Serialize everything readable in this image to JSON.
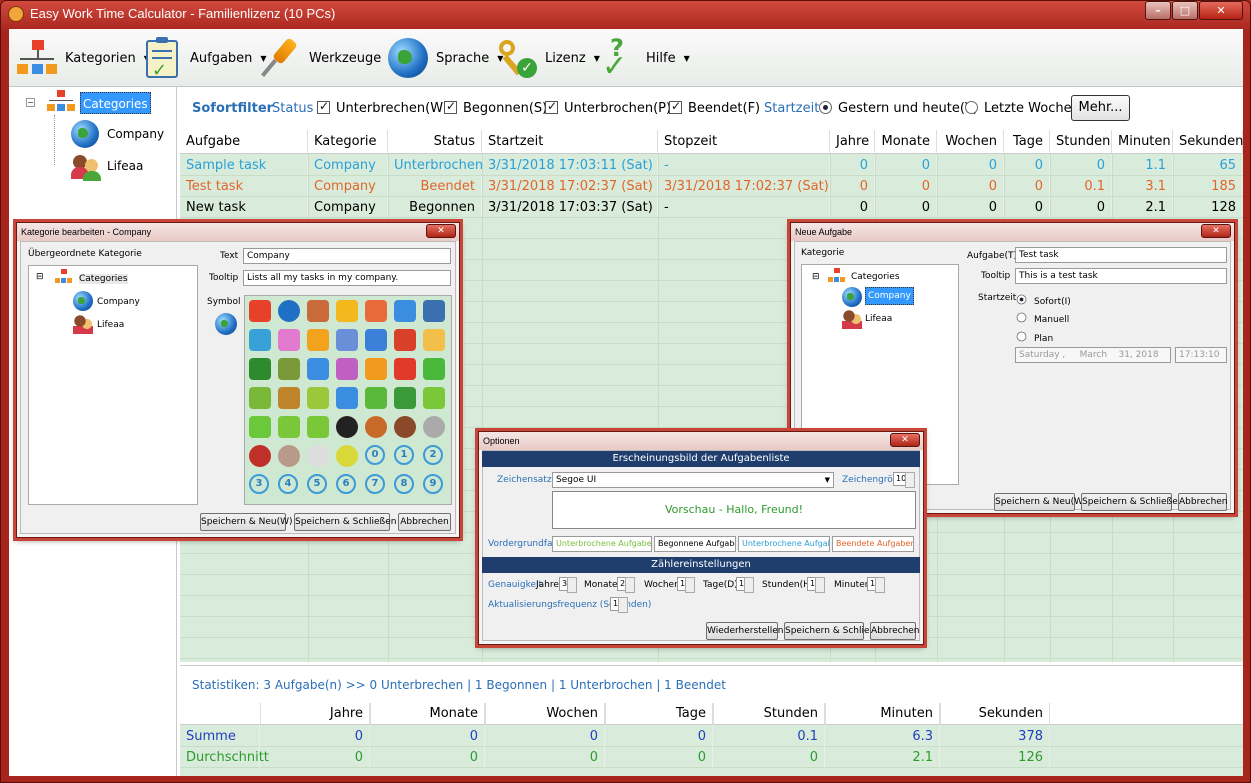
{
  "app": {
    "title": "Easy Work Time Calculator - Familienlizenz (10 PCs)"
  },
  "toolbar": [
    {
      "label": "Kategorien",
      "icon": "category-tree-icon"
    },
    {
      "label": "Aufgaben",
      "icon": "clipboard-icon"
    },
    {
      "label": "Werkzeuge",
      "icon": "screwdriver-icon"
    },
    {
      "label": "Sprache",
      "icon": "globe-icon"
    },
    {
      "label": "Lizenz",
      "icon": "keys-icon"
    },
    {
      "label": "Hilfe",
      "icon": "help-check-icon"
    }
  ],
  "tree": {
    "root": "Categories",
    "children": [
      "Company",
      "Lifeaa"
    ]
  },
  "filter": {
    "title": "Sofortfilter",
    "status_label": "Status",
    "status_options": [
      {
        "label": "Unterbrechen(W)",
        "checked": true
      },
      {
        "label": "Begonnen(S)",
        "checked": true
      },
      {
        "label": "Unterbrochen(P)",
        "checked": true
      },
      {
        "label": "Beendet(F)",
        "checked": true
      }
    ],
    "time_label": "Startzeit",
    "time_options": [
      {
        "label": "Gestern und heute(Y)",
        "selected": true
      },
      {
        "label": "Letzte Woche",
        "selected": false
      }
    ],
    "more_button": "Mehr..."
  },
  "grid": {
    "columns": [
      "Aufgabe",
      "Kategorie",
      "Status",
      "Startzeit",
      "Stopzeit",
      "Jahre",
      "Monate",
      "Wochen",
      "Tage",
      "Stunden",
      "Minuten",
      "Sekunden"
    ],
    "rows": [
      {
        "cells": [
          "Sample task",
          "Company",
          "Unterbrochen",
          "3/31/2018 17:03:11 (Sat)",
          "-",
          "0",
          "0",
          "0",
          "0",
          "0",
          "1.1",
          "65"
        ],
        "color": "#2aa0d8"
      },
      {
        "cells": [
          "Test task",
          "Company",
          "Beendet",
          "3/31/2018 17:02:37 (Sat)",
          "3/31/2018 17:02:37 (Sat)",
          "0",
          "0",
          "0",
          "0",
          "0.1",
          "3.1",
          "185"
        ],
        "color": "#e2652a"
      },
      {
        "cells": [
          "New task",
          "Company",
          "Begonnen",
          "3/31/2018 17:03:37 (Sat)",
          "-",
          "0",
          "0",
          "0",
          "0",
          "0",
          "2.1",
          "128"
        ],
        "color": "#000000"
      }
    ]
  },
  "stats": {
    "text": "Statistiken: 3 Aufgabe(n) >> 0 Unterbrechen | 1 Begonnen | 1 Unterbrochen | 1 Beendet"
  },
  "summary": {
    "columns": [
      "Jahre",
      "Monate",
      "Wochen",
      "Tage",
      "Stunden",
      "Minuten",
      "Sekunden"
    ],
    "rows": [
      {
        "label": "Summe",
        "values": [
          "0",
          "0",
          "0",
          "0",
          "0.1",
          "6.3",
          "378"
        ],
        "color": "#1f3fbf"
      },
      {
        "label": "Durchschnitt",
        "values": [
          "0",
          "0",
          "0",
          "0",
          "0",
          "2.1",
          "126"
        ],
        "color": "#2e9a2e"
      }
    ]
  },
  "edit_dialog": {
    "title": "Kategorie bearbeiten - Company",
    "parent_label": "Übergeordnete Kategorie",
    "tree_root": "Categories",
    "tree_children": [
      "Company",
      "Lifeaa"
    ],
    "text_label": "Text",
    "text_value": "Company",
    "tooltip_label": "Tooltip",
    "tooltip_value": "Lists all my tasks in my company.",
    "symbol_label": "Symbol",
    "circle_numbers": [
      "0",
      "1",
      "2",
      "3",
      "4",
      "5",
      "6",
      "7",
      "8",
      "9"
    ],
    "buttons": [
      "Speichern & Neu(W)",
      "Speichern & Schließen",
      "Abbrechen"
    ]
  },
  "new_task_dialog": {
    "title": "Neue Aufgabe",
    "category_label": "Kategorie",
    "tree_root": "Categories",
    "tree_children": [
      "Company",
      "Lifeaa"
    ],
    "task_label": "Aufgabe(T)",
    "task_value": "Test task",
    "tooltip_label": "Tooltip",
    "tooltip_value": "This is a test task",
    "start_label": "Startzeit",
    "start_options": [
      {
        "label": "Sofort(I)",
        "selected": true
      },
      {
        "label": "Manuell",
        "selected": false
      },
      {
        "label": "Plan",
        "selected": false
      }
    ],
    "date_day": "Saturday",
    "date_month": "March",
    "date_rest": "31, 2018",
    "time_value": "17:13:10",
    "buttons": [
      "Speichern & Neu(W)",
      "Speichern & Schließen",
      "Abbrechen"
    ]
  },
  "options_dialog": {
    "title": "Optionen",
    "section1": "Erscheinungsbild der Aufgabenliste",
    "font_label": "Zeichensatz(O)",
    "font_value": "Segoe UI",
    "size_label": "Zeichengröße",
    "size_value": "10",
    "preview": "Vorschau - Hallo, Freund!",
    "fg_label": "Vordergrundfarbe",
    "fg_items": [
      {
        "label": "Unterbrochene Aufgaben(S)",
        "color": "#7bbd3a"
      },
      {
        "label": "Begonnene Aufgaben(T)",
        "color": "#000000"
      },
      {
        "label": "Unterbrochene Aufgaben",
        "color": "#2aa0d8"
      },
      {
        "label": "Beendete Aufgaben(K)",
        "color": "#e2652a"
      }
    ],
    "section2": "Zählereinstellungen",
    "precision_label": "Genauigkeit",
    "precision": [
      {
        "label": "Jahre",
        "value": "3"
      },
      {
        "label": "Monate",
        "value": "2"
      },
      {
        "label": "Wochen",
        "value": "1"
      },
      {
        "label": "Tage(D)",
        "value": "1"
      },
      {
        "label": "Stunden(H)",
        "value": "1"
      },
      {
        "label": "Minuten",
        "value": "1"
      }
    ],
    "refresh_label": "Aktualisierungsfrequenz (Sekunden)",
    "refresh_value": "1",
    "buttons": [
      "Wiederherstellen",
      "Speichern & Schließen",
      "Abbrechen"
    ]
  }
}
